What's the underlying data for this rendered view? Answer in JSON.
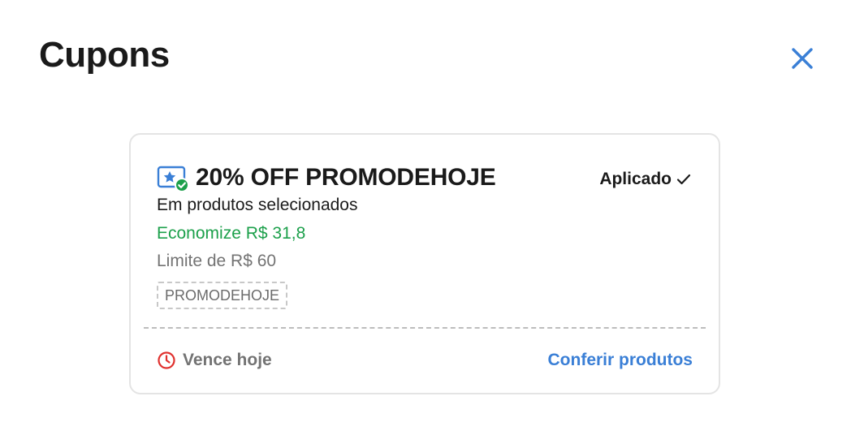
{
  "modal": {
    "title": "Cupons",
    "close_icon": "close-icon",
    "accent_color": "#3a7fd6"
  },
  "coupon": {
    "icon": "coupon-star-check-icon",
    "title": "20% OFF PROMODEHOJE",
    "status_label": "Aplicado",
    "status_icon": "checkmark-icon",
    "subtitle": "Em produtos selecionados",
    "savings": "Economize R$ 31,8",
    "limit": "Limite de R$ 60",
    "code": "PROMODEHOJE",
    "expiry_icon": "clock-icon",
    "expiry": "Vence hoje",
    "cta_label": "Conferir produtos",
    "colors": {
      "savings": "#1ca04b",
      "expiry_icon": "#e0312e",
      "link": "#3a7fd6"
    }
  }
}
